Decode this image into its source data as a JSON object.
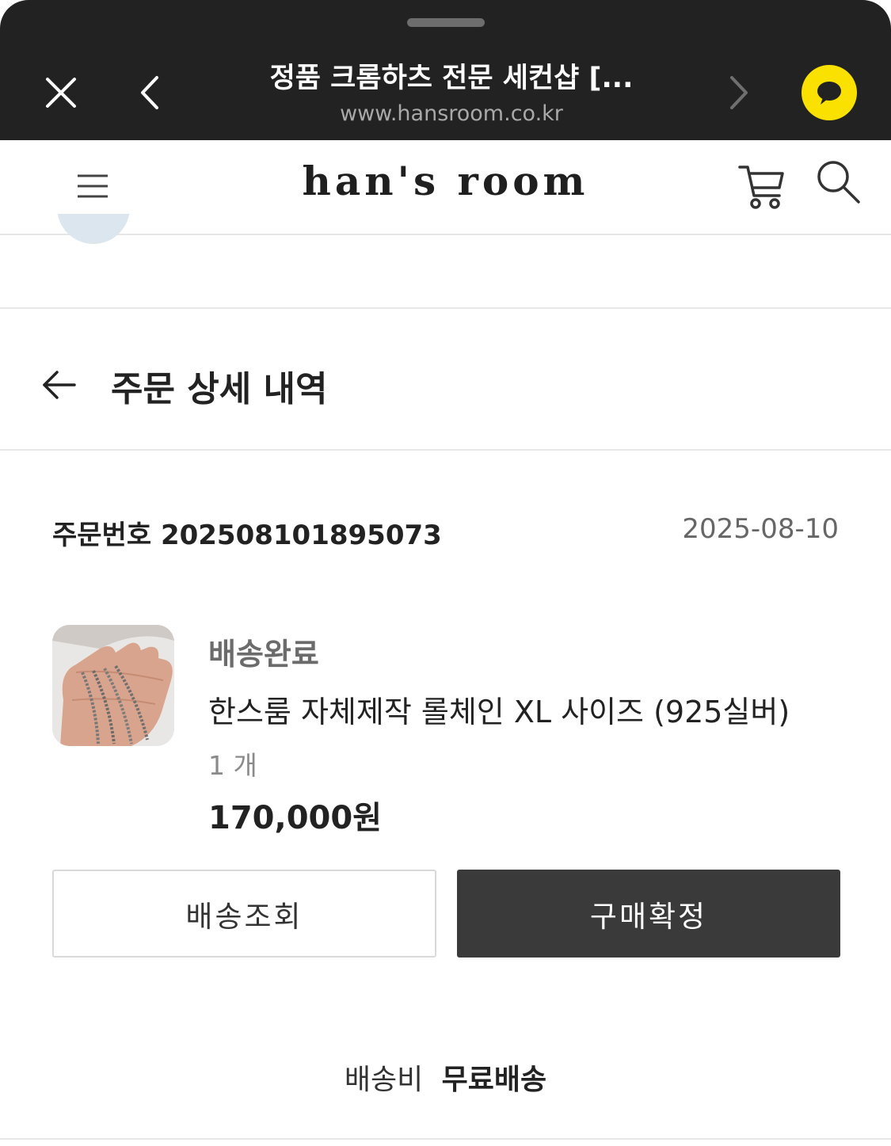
{
  "browser": {
    "title": "정품 크롬하츠 전문 세컨샵 [...",
    "url": "www.hansroom.co.kr"
  },
  "header": {
    "logo_text": "han's room"
  },
  "order_detail": {
    "title": "주문 상세 내역",
    "order_number_label": "주문번호 202508101895073",
    "order_date": "2025-08-10",
    "item": {
      "status": "배송완료",
      "name": "한스룸 자체제작 롤체인 XL 사이즈 (925실버)",
      "quantity": "1 개",
      "price": "170,000원"
    },
    "buttons": {
      "track": "배송조회",
      "confirm": "구매확정"
    },
    "shipping": {
      "label": "배송비",
      "value": "무료배송"
    }
  },
  "colors": {
    "browser_bar": "#222222",
    "kakao": "#fae100",
    "confirm_button": "#3a3a3a"
  },
  "icons": [
    "close-icon",
    "chevron-left-icon",
    "chevron-right-icon",
    "kakao-chat-icon",
    "hamburger-icon",
    "cart-icon",
    "search-icon",
    "arrow-left-icon"
  ]
}
